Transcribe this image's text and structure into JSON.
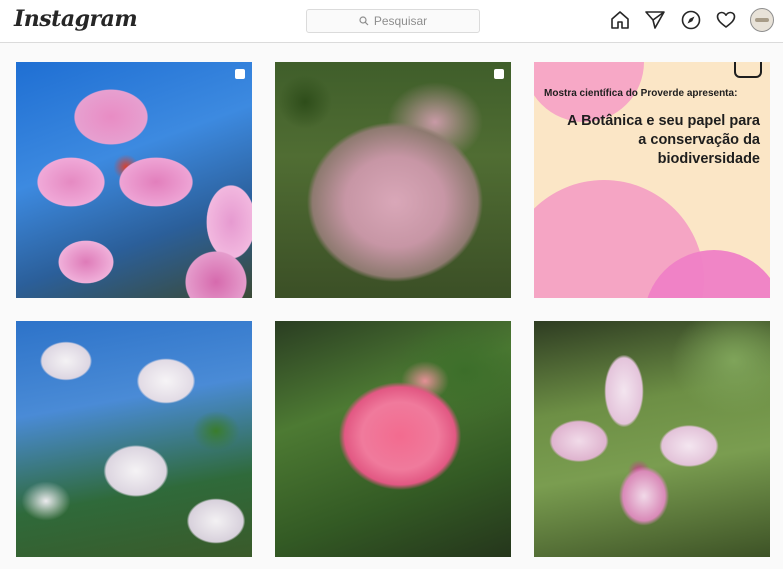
{
  "header": {
    "logo": "Instagram",
    "search_placeholder": "Pesquisar",
    "icons": [
      "home-icon",
      "direct-send-icon",
      "explore-compass-icon",
      "activity-heart-icon",
      "profile-avatar"
    ]
  },
  "posts": [
    {
      "type": "image",
      "subject": "pink flowers",
      "multi": true
    },
    {
      "type": "image",
      "subject": "pink shrub",
      "multi": true
    },
    {
      "type": "image",
      "subject": "promo",
      "multi": false,
      "subtitle": "Mostra científica do Proverde apresenta:",
      "title_line1": "A Botânica e seu papel para",
      "title_line2": "a conservação da",
      "title_line3": "biodiversidade"
    },
    {
      "type": "image",
      "subject": "white flowers",
      "multi": false
    },
    {
      "type": "image",
      "subject": "pink flower cluster",
      "multi": false
    },
    {
      "type": "image",
      "subject": "pink and white flower",
      "multi": false
    }
  ],
  "colors": {
    "promo_background": "#fbe6c6",
    "promo_accent": "#d11d7e",
    "border": "#dbdbdb"
  }
}
